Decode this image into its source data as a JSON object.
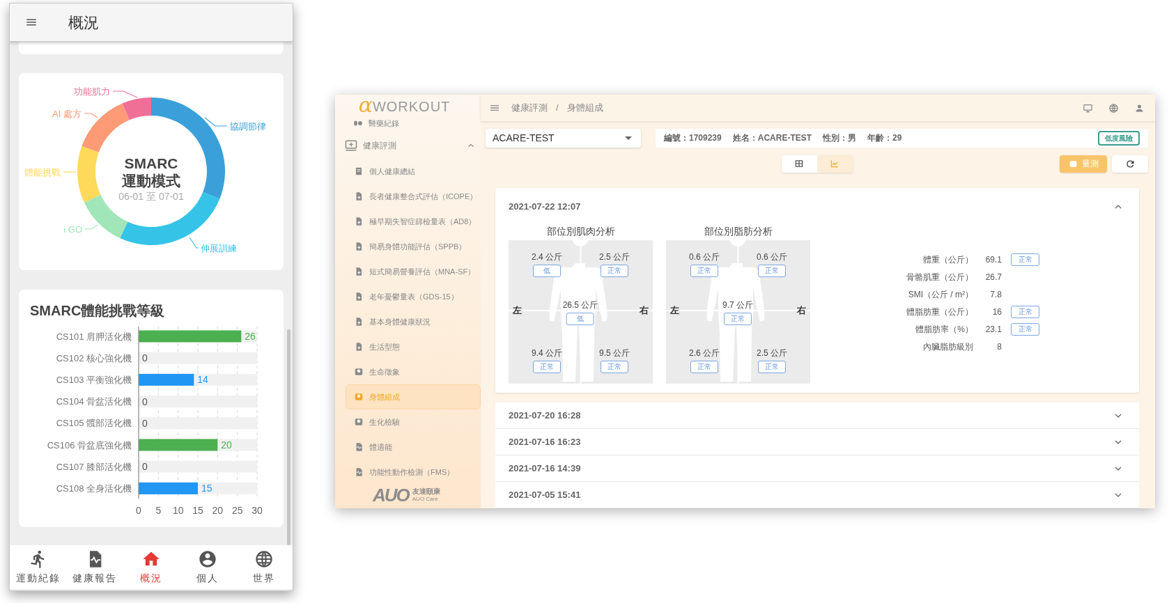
{
  "phone": {
    "header": {
      "title": "概況"
    },
    "activity_modes": {
      "title": "SMARC",
      "subtitle": "運動模式",
      "date_range": "06-01 至 07-01",
      "segments": [
        {
          "label": "協調節律",
          "color": "#3ba0d9"
        },
        {
          "label": "伸展訓練",
          "color": "#35c4e8"
        },
        {
          "label": "i GO",
          "color": "#a0e6b8"
        },
        {
          "label": "體能挑戰",
          "color": "#ffd95a"
        },
        {
          "label": "AI 處方",
          "color": "#ff9a76"
        },
        {
          "label": "功能肌力",
          "color": "#f06f96"
        }
      ]
    },
    "challenge_levels": {
      "title": "SMARC體能挑戰等級",
      "chart_data": {
        "type": "bar",
        "orientation": "horizontal",
        "categories": [
          "CS101 肩胛活化機",
          "CS102 核心強化機",
          "CS103 平衡強化機",
          "CS104 骨盆活化機",
          "CS105 髖部活化機",
          "CS106 骨盆底強化機",
          "CS107 膝部活化機",
          "CS108 全身活化機"
        ],
        "values": [
          26,
          0,
          14,
          0,
          0,
          20,
          0,
          15
        ],
        "colors": [
          "#4caf50",
          "#4caf50",
          "#2196f3",
          "#2196f3",
          "#4caf50",
          "#4caf50",
          "#2196f3",
          "#2196f3"
        ],
        "xlim": [
          0,
          30
        ],
        "xticks": [
          0,
          5,
          10,
          15,
          20,
          25,
          30
        ],
        "grid": true,
        "data_labels": true
      }
    },
    "bottom_nav": [
      {
        "label": "運動紀錄",
        "kind": "run",
        "selected": false
      },
      {
        "label": "健康報告",
        "kind": "report",
        "selected": false
      },
      {
        "label": "概況",
        "kind": "home",
        "selected": true
      },
      {
        "label": "個人",
        "kind": "person",
        "selected": false
      },
      {
        "label": "世界",
        "kind": "globe",
        "selected": false
      }
    ]
  },
  "app": {
    "logo": {
      "symbol": "α",
      "text": "WORKOUT"
    },
    "sidebar": {
      "items": [
        {
          "label": "醫藥紀錄",
          "kind": "pills",
          "selected": false,
          "expanded": false
        },
        {
          "label": "健康評測",
          "kind": "monitor",
          "selected": false,
          "expanded": true,
          "children": [
            {
              "label": "個人健康總結",
              "kind": "book",
              "selected": false
            },
            {
              "label": "長者健康整合式評估（ICOPE）",
              "kind": "form",
              "selected": false
            },
            {
              "label": "極早期失智症篩檢量表（AD8）",
              "kind": "form",
              "selected": false
            },
            {
              "label": "簡易身體功能評估（SPPB）",
              "kind": "form",
              "selected": false
            },
            {
              "label": "短式簡易營養評估（MNA-SF）",
              "kind": "form",
              "selected": false
            },
            {
              "label": "老年憂鬱量表（GDS-15）",
              "kind": "form",
              "selected": false
            },
            {
              "label": "基本身體健康狀況",
              "kind": "form",
              "selected": false
            },
            {
              "label": "生活型態",
              "kind": "form",
              "selected": false
            },
            {
              "label": "生命徵象",
              "kind": "scale",
              "selected": false
            },
            {
              "label": "身體組成",
              "kind": "scale",
              "selected": true
            },
            {
              "label": "生化檢驗",
              "kind": "scale",
              "selected": false
            },
            {
              "label": "體適能",
              "kind": "pulse",
              "selected": false
            },
            {
              "label": "功能性動作檢測（FMS）",
              "kind": "pulse",
              "selected": false
            }
          ]
        }
      ]
    },
    "footer_logo": {
      "brand": "AUO",
      "name": "友達頤康",
      "subname": "AUO Care"
    },
    "breadcrumb": {
      "separator": "/",
      "items": [
        "健康評測",
        "身體組成"
      ]
    },
    "patient_select": {
      "value": "ACARE-TEST"
    },
    "patient_info": [
      "編號：1709239",
      "姓名：ACARE-TEST",
      "性別：男",
      "年齡：29"
    ],
    "risk_badge": "低度風險",
    "view_toggle": [
      {
        "kind": "table",
        "selected": false
      },
      {
        "kind": "chart",
        "selected": true
      }
    ],
    "measure_button": "量測",
    "records": [
      {
        "datetime": "2021-07-22 12:07",
        "expanded": true,
        "muscle_analysis": {
          "title": "部位別肌肉分析",
          "left_label": "左",
          "right_label": "右",
          "segments": [
            {
              "value": "2.4 公斤",
              "status": "低"
            },
            {
              "value": "2.5 公斤",
              "status": "正常"
            },
            {
              "value": "26.5 公斤",
              "status": "低"
            },
            {
              "value": "9.4 公斤",
              "status": "正常"
            },
            {
              "value": "9.5 公斤",
              "status": "正常"
            }
          ]
        },
        "fat_analysis": {
          "title": "部位別脂肪分析",
          "left_label": "左",
          "right_label": "右",
          "segments": [
            {
              "value": "0.6 公斤",
              "status": "正常"
            },
            {
              "value": "0.6 公斤",
              "status": "正常"
            },
            {
              "value": "9.7 公斤",
              "status": "正常"
            },
            {
              "value": "2.6 公斤",
              "status": "正常"
            },
            {
              "value": "2.5 公斤",
              "status": "正常"
            }
          ]
        },
        "metrics": [
          {
            "label": "體重（公斤）",
            "value": "69.1",
            "status": "正常"
          },
          {
            "label": "骨骼肌重（公斤）",
            "value": "26.7"
          },
          {
            "label": "SMI（公斤 / m²）",
            "value": "7.8"
          },
          {
            "label": "體脂肪重（公斤）",
            "value": "16",
            "status": "正常"
          },
          {
            "label": "體脂肪率（%）",
            "value": "23.1",
            "status": "正常"
          },
          {
            "label": "內臟脂肪級別",
            "value": "8"
          }
        ]
      },
      {
        "datetime": "2021-07-20 16:28",
        "expanded": false
      },
      {
        "datetime": "2021-07-16 16:23",
        "expanded": false
      },
      {
        "datetime": "2021-07-16 14:39",
        "expanded": false
      },
      {
        "datetime": "2021-07-05 15:41",
        "expanded": false
      }
    ]
  }
}
